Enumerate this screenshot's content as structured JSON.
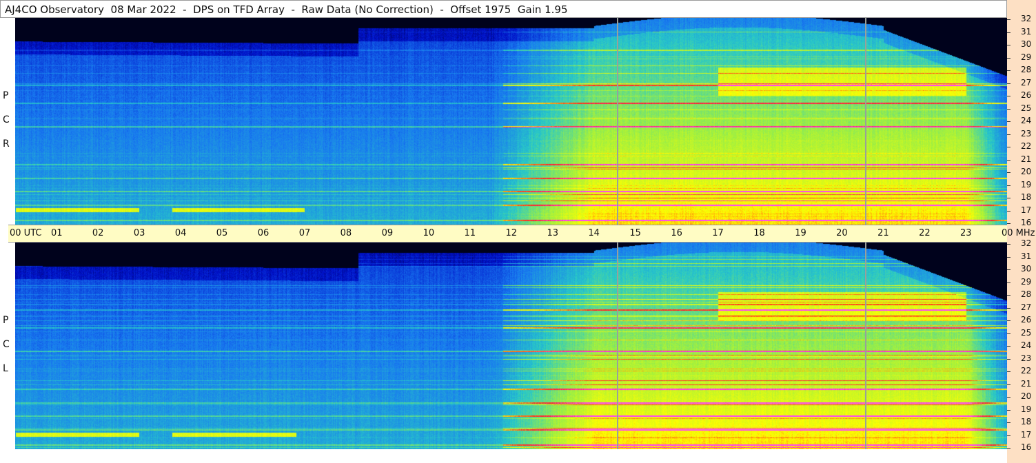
{
  "title": "AJ4CO Observatory  08 Mar 2022  -  DPS on TFD Array  -  Raw Data (No Correction)  -  Offset 1975  Gain 1.95",
  "colors": {
    "time_axis_bg": "#fffcc4",
    "right_strip_bg": "#fde0c4",
    "marker_line": "#9aa09a"
  },
  "chart_data": {
    "type": "heatmap",
    "panels": [
      {
        "label": "R C P",
        "letters": [
          "P",
          "C",
          "R"
        ]
      },
      {
        "label": "L C P",
        "letters": [
          "P",
          "C",
          "L"
        ]
      }
    ],
    "x_axis": {
      "unit": "UTC",
      "ticks": [
        "00",
        "01",
        "02",
        "03",
        "04",
        "05",
        "06",
        "07",
        "08",
        "09",
        "10",
        "11",
        "12",
        "13",
        "14",
        "15",
        "16",
        "17",
        "18",
        "19",
        "20",
        "21",
        "22",
        "23",
        "00"
      ],
      "first_label": "00  UTC",
      "last_label": "00 MHz",
      "range": [
        0,
        24
      ]
    },
    "y_axis": {
      "unit": "MHz",
      "range": [
        16,
        32
      ],
      "ticks": [
        "32",
        "31",
        "30",
        "29",
        "28",
        "27",
        "26",
        "25",
        "24",
        "23",
        "22",
        "21",
        "20",
        "19",
        "18",
        "17",
        "16"
      ]
    },
    "markers_utc": [
      14.58,
      20.58
    ],
    "colormap": [
      "#000000",
      "#0010c8",
      "#1878f0",
      "#28c8c8",
      "#a0f040",
      "#ffff00",
      "#ff2020",
      "#ff40ff"
    ]
  }
}
